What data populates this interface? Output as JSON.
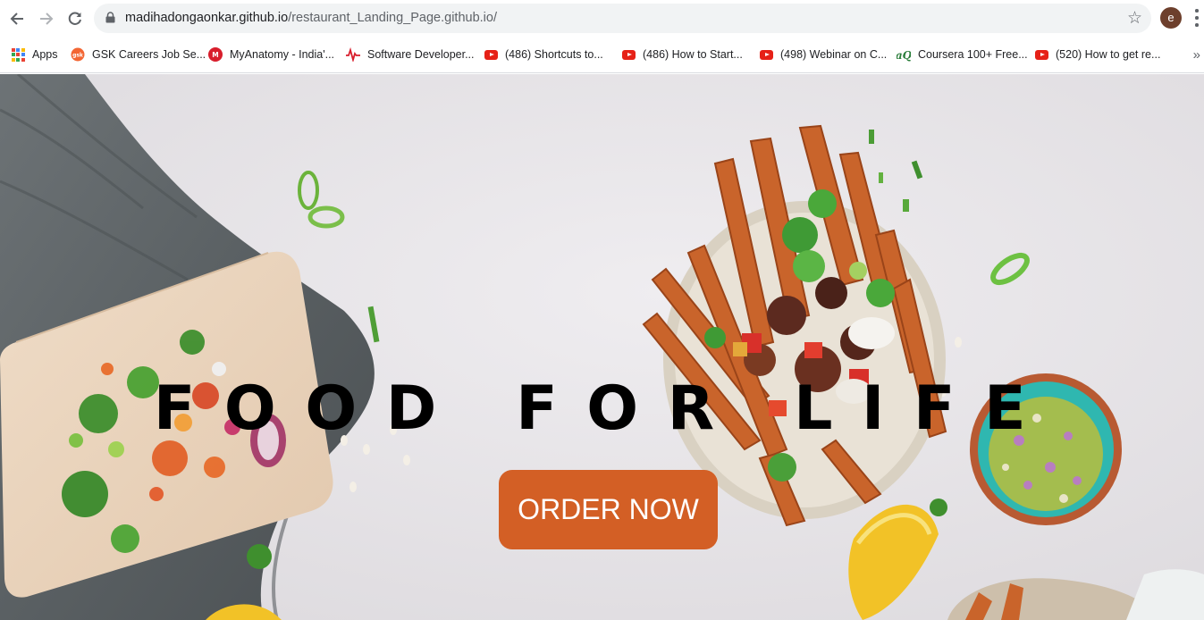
{
  "browser": {
    "url_domain": "madihadongaonkar.github.io",
    "url_path": "/restaurant_Landing_Page.github.io/",
    "avatar_letter": "e"
  },
  "bookmarks": {
    "items": [
      {
        "label": "Apps",
        "icon": "apps-grid-icon"
      },
      {
        "label": "GSK Careers Job Se...",
        "icon": "gsk-icon"
      },
      {
        "label": "MyAnatomy - India'...",
        "icon": "myanatomy-icon"
      },
      {
        "label": "Software Developer...",
        "icon": "pulse-icon"
      },
      {
        "label": "(486) Shortcuts to...",
        "icon": "youtube-icon"
      },
      {
        "label": "(486) How to Start...",
        "icon": "youtube-icon"
      },
      {
        "label": "(498) Webinar on C...",
        "icon": "youtube-icon"
      },
      {
        "label": "Coursera 100+ Free...",
        "icon": "coursera-icon"
      },
      {
        "label": "(520) How to get re...",
        "icon": "youtube-icon"
      }
    ],
    "more_label": "»"
  },
  "hero": {
    "title": "FOOD FOR LIFE",
    "cta_label": "ORDER NOW",
    "cta_color": "#d35f25"
  },
  "colors": {
    "youtube_red": "#e62117",
    "hero_background": "#e9e7ea"
  }
}
